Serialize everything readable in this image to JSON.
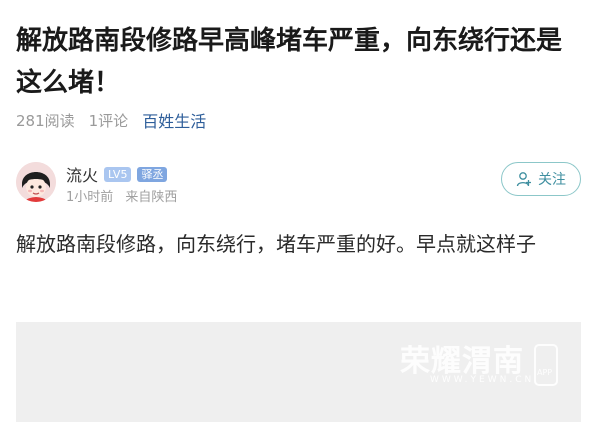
{
  "article": {
    "title": "解放路南段修路早高峰堵车严重，向东绕行还是这么堵！",
    "read_count": "281阅读",
    "comment_count": "1评论",
    "circle": "百姓生活"
  },
  "author": {
    "name": "流火",
    "level": "LV5",
    "rank": "驿丞",
    "time": "1小时前",
    "location": "来自陕西",
    "follow_label": "关注"
  },
  "content": {
    "text": "解放路南段修路，向东绕行，堵车严重的好。早点就这样子"
  },
  "image_watermark": {
    "brand": "荣耀渭南",
    "site": "WWW.YEWN.CN",
    "app_label": "APP"
  },
  "colors": {
    "circle_link": "#2e5e9a",
    "follow_border": "#8cc7c9",
    "follow_text": "#3f8fa0",
    "level_badge": "#aac6f0",
    "rank_badge": "#7fa6e0"
  }
}
